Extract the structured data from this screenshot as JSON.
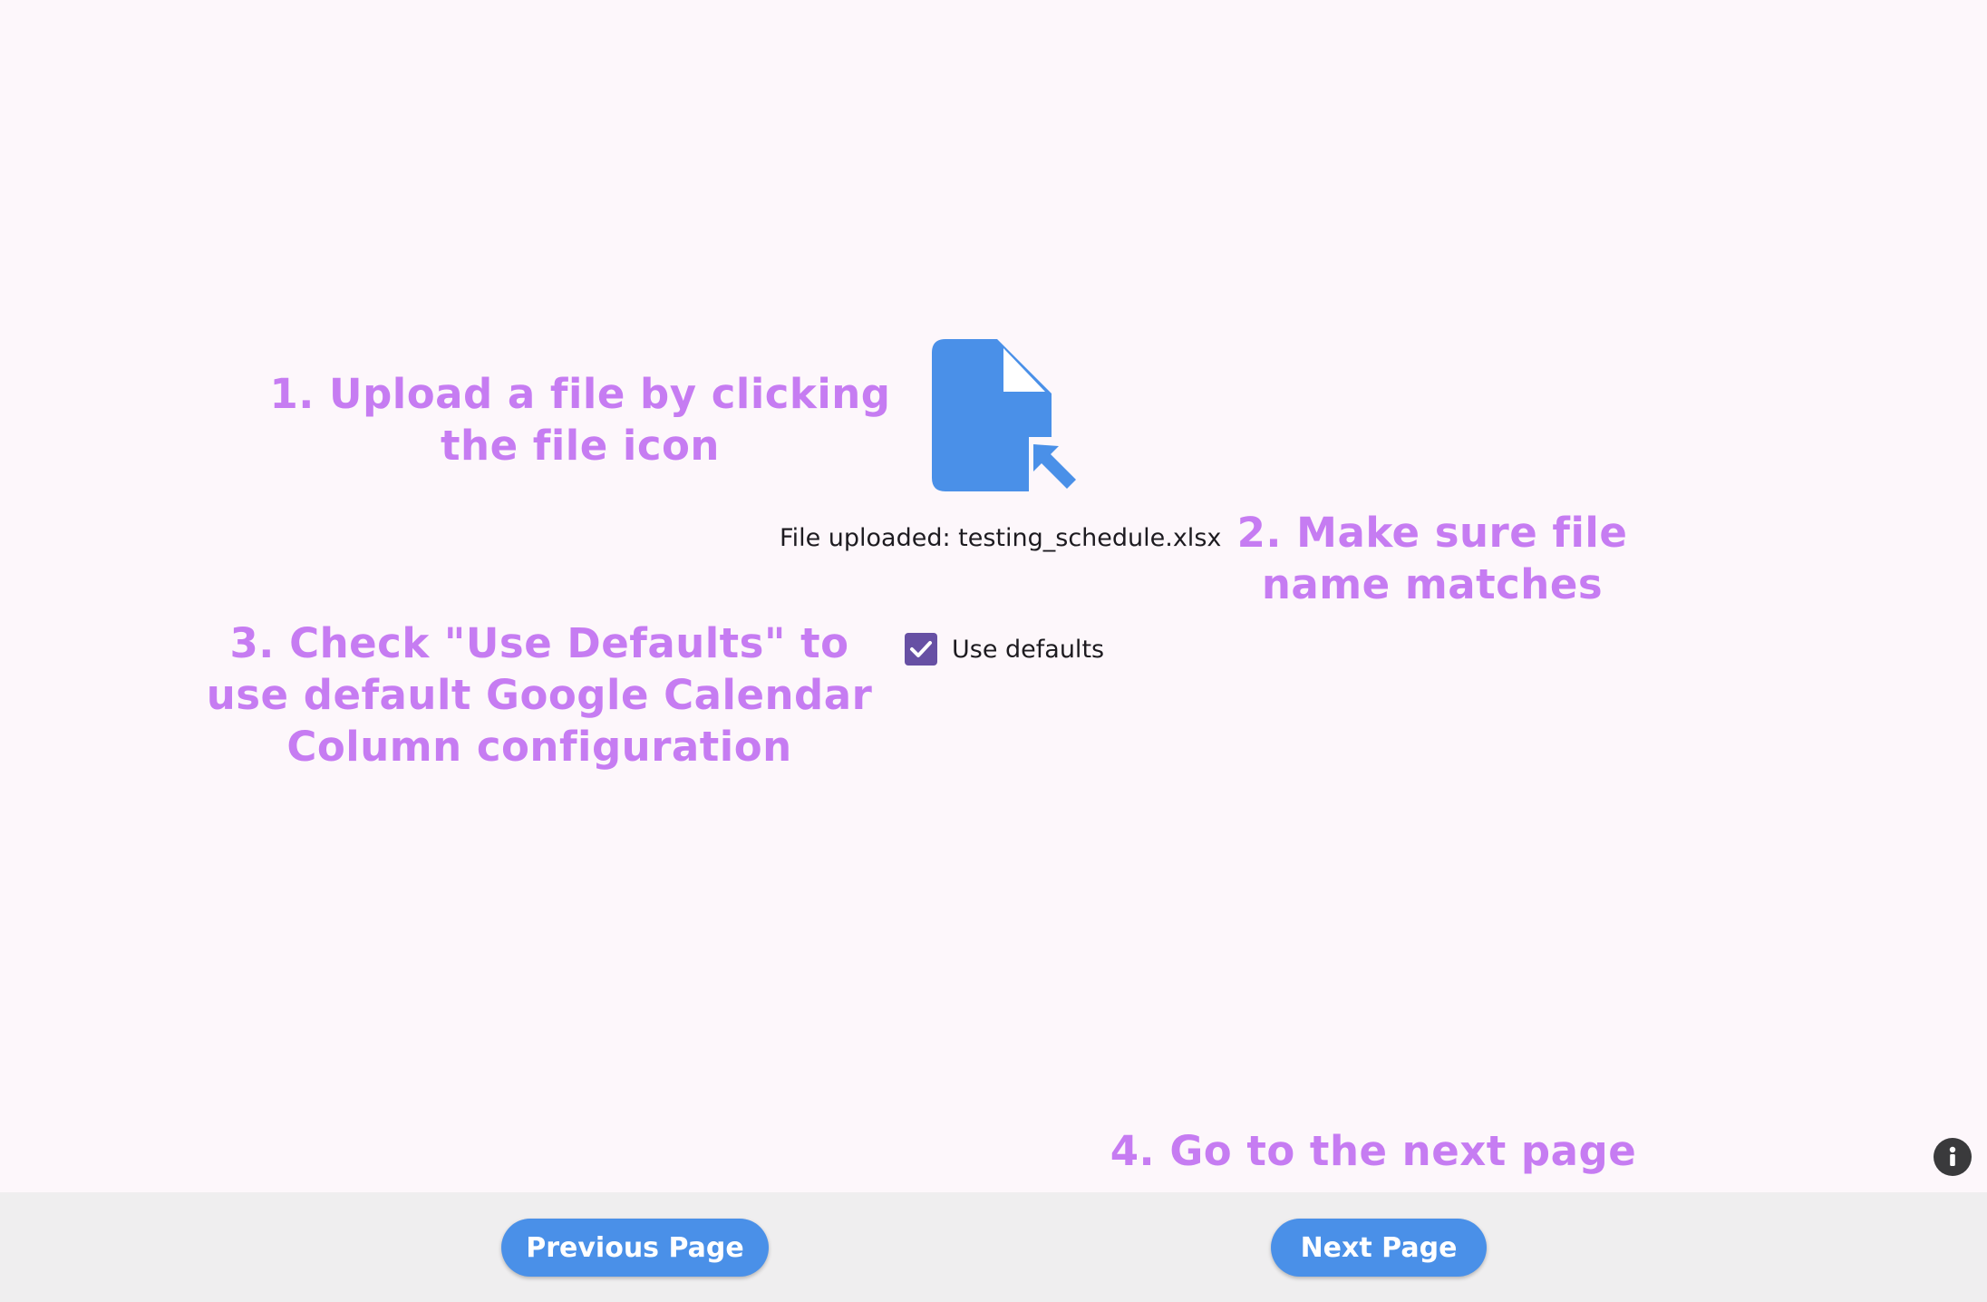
{
  "annotations": {
    "step1_line1": "1. Upload a file by clicking",
    "step1_line2": "the file icon",
    "step2_line1": "2. Make sure file",
    "step2_line2": "name matches",
    "step3_line1": "3. Check \"Use Defaults\" to",
    "step3_line2": "use default Google Calendar",
    "step3_line3": "Column configuration",
    "step4": "4. Go to the next page"
  },
  "upload": {
    "icon": "file-upload-icon",
    "status_text": "File uploaded: testing_schedule.xlsx"
  },
  "options": {
    "use_defaults_label": "Use defaults",
    "use_defaults_checked": true
  },
  "navigation": {
    "previous_label": "Previous Page",
    "next_label": "Next Page"
  },
  "info": {
    "icon": "info-icon"
  },
  "colors": {
    "background": "#fdf7fb",
    "annotation": "#c67cf2",
    "accent_blue": "#4a90e8",
    "checkbox": "#6750a4",
    "bottom_bar": "#efeeef"
  }
}
